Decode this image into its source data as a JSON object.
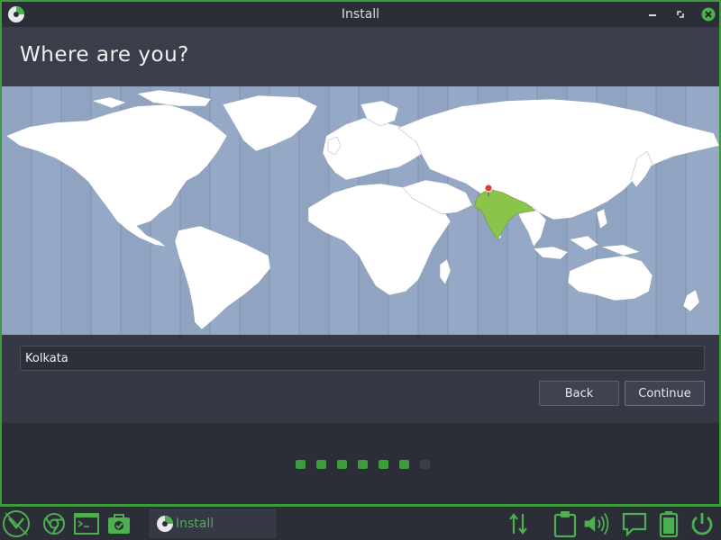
{
  "window": {
    "title": "Install",
    "heading": "Where are you?"
  },
  "location": {
    "value": "Kolkata",
    "highlighted_country": "India"
  },
  "buttons": {
    "back": "Back",
    "continue": "Continue"
  },
  "progress": {
    "total_steps": 7,
    "completed_steps": 6
  },
  "taskbar": {
    "task_label": "Install",
    "icons": [
      "mint-menu-icon",
      "chrome-icon",
      "terminal-icon",
      "software-icon",
      "network-icon",
      "clipboard-icon",
      "volume-icon",
      "chat-icon",
      "battery-icon",
      "power-icon"
    ]
  },
  "colors": {
    "accent": "#3d9b3d",
    "map_water": "#95a9c6",
    "map_land": "#ffffff",
    "map_highlight": "#8cc34a",
    "pin": "#e53935"
  }
}
